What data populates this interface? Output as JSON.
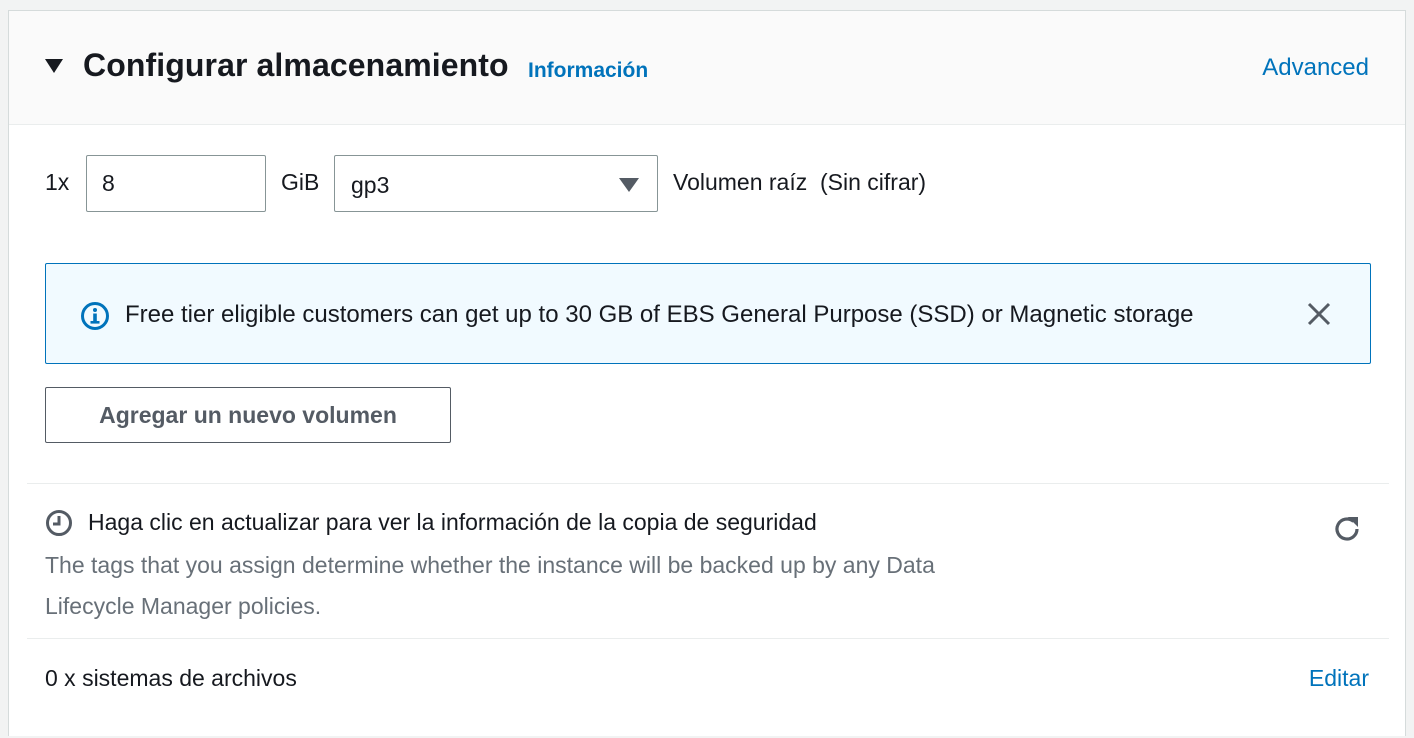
{
  "header": {
    "title": "Configurar almacenamiento",
    "info_link": "Información",
    "advanced_link": "Advanced"
  },
  "volume": {
    "count": "1x",
    "size_value": "8",
    "unit": "GiB",
    "type_selected": "gp3",
    "description": "Volumen raíz  (Sin cifrar)"
  },
  "alert": {
    "message": "Free tier eligible customers can get up to 30 GB of EBS General Purpose (SSD) or Magnetic storage"
  },
  "add_volume_button": "Agregar un nuevo volumen",
  "backup": {
    "title": "Haga clic en actualizar para ver la información de la copia de seguridad",
    "description": "The tags that you assign determine whether the instance will be backed up by any Data Lifecycle Manager policies."
  },
  "filesystems": {
    "label": "0 x sistemas de archivos",
    "edit_link": "Editar"
  },
  "colors": {
    "link": "#0073bb",
    "alert_bg": "#f1faff",
    "muted_text": "#687078"
  },
  "icons": [
    "caret-down-icon",
    "dropdown-arrow-icon",
    "info-icon",
    "close-icon",
    "clock-icon",
    "refresh-icon"
  ]
}
